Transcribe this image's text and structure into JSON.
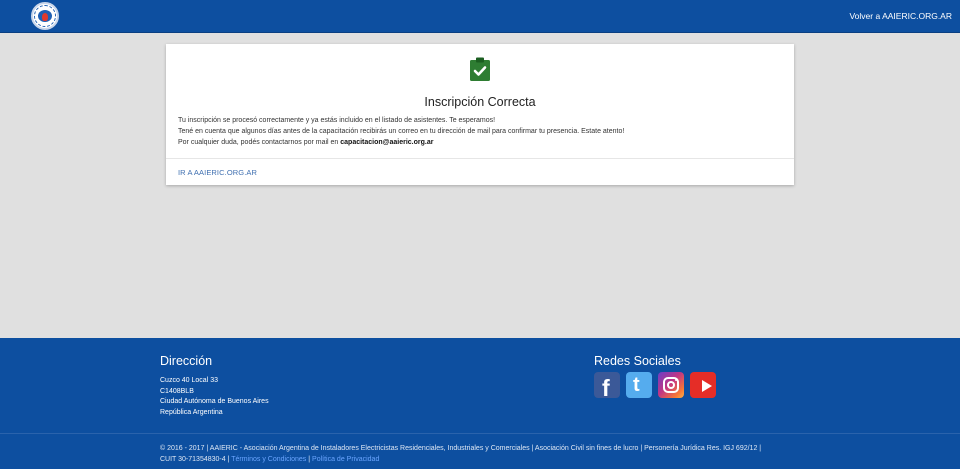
{
  "header": {
    "logo_text": "AAIERIC",
    "back_link": "Volver a AAIERIC.ORG.AR"
  },
  "card": {
    "icon": "clipboard-check-icon",
    "title": "Inscripción Correcta",
    "line1": "Tu inscripción se procesó correctamente y ya estás incluido en el listado de asistentes. Te esperamos!",
    "line2": "Tené en cuenta que algunos días antes de la capacitación recibirás un correo en tu dirección de mail para confirmar tu presencia. Estate atento!",
    "line3_prefix": "Por cualquier duda, podés contactarnos por mail en ",
    "email": "capacitacion@aaieric.org.ar",
    "action": "IR A AAIERIC.ORG.AR"
  },
  "footer": {
    "direccion_title": "Dirección",
    "address": [
      "Cuzco 40 Local 33",
      "C1408BLB",
      "Ciudad Autónoma de Buenos Aires",
      "República Argentina"
    ],
    "social_title": "Redes Sociales",
    "social": [
      {
        "name": "facebook",
        "icon": "facebook-icon"
      },
      {
        "name": "twitter",
        "icon": "twitter-icon"
      },
      {
        "name": "instagram",
        "icon": "instagram-icon"
      },
      {
        "name": "youtube",
        "icon": "youtube-icon"
      }
    ],
    "copyright": "© 2016 - 2017 | AAIERIC - Asociación Argentina de Instaladores Electricistas Residenciales, Industriales y Comerciales | Asociación Civil sin fines de lucro | Personería Jurídica Res. IGJ 692/12 |",
    "cuit": "CUIT 30-71354830-4 | ",
    "terms": "Términos y Condiciones",
    "sep": " | ",
    "privacy": "Política de Privacidad"
  },
  "colors": {
    "brand_blue": "#0d4fa0",
    "success_green": "#2e7d32",
    "link_blue": "#3f6fb0"
  }
}
